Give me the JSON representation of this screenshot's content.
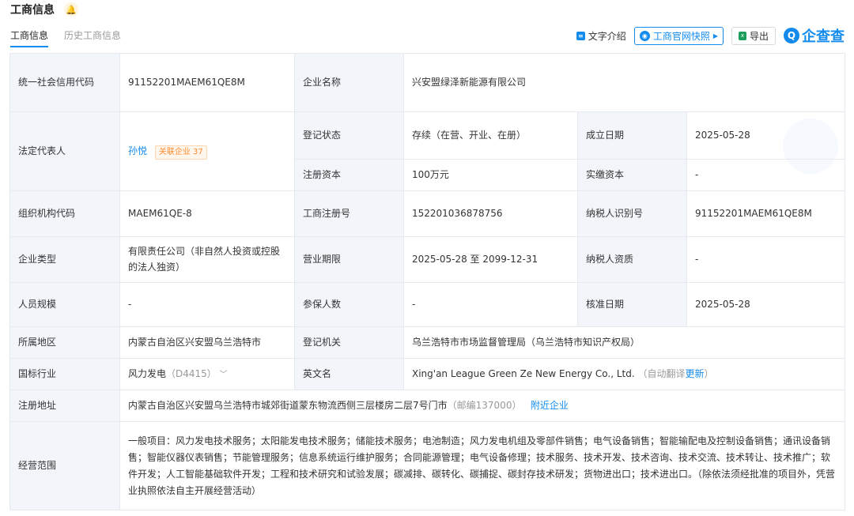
{
  "header": {
    "title": "工商信息"
  },
  "tabs": [
    {
      "label": "工商信息"
    },
    {
      "label": "历史工商信息"
    }
  ],
  "toolbar": {
    "text_intro": "文字介绍",
    "snapshot": "工商官网快照",
    "export": "导出",
    "logo_text": "企查查"
  },
  "rows": {
    "credit_code": {
      "label": "统一社会信用代码",
      "value": "91152201MAEM61QE8M"
    },
    "company_name": {
      "label": "企业名称",
      "value": "兴安盟绿泽新能源有限公司"
    },
    "legal_rep": {
      "label": "法定代表人",
      "name": "孙悦",
      "tag": "关联企业 37"
    },
    "reg_status": {
      "label": "登记状态",
      "value": "存续（在营、开业、在册）"
    },
    "est_date": {
      "label": "成立日期",
      "value": "2025-05-28"
    },
    "reg_capital": {
      "label": "注册资本",
      "value": "100万元"
    },
    "paid_capital": {
      "label": "实缴资本",
      "value": "-"
    },
    "org_code": {
      "label": "组织机构代码",
      "value": "MAEM61QE-8"
    },
    "reg_no": {
      "label": "工商注册号",
      "value": "152201036878756"
    },
    "taxpayer_id": {
      "label": "纳税人识别号",
      "value": "91152201MAEM61QE8M"
    },
    "company_type": {
      "label": "企业类型",
      "value": "有限责任公司（非自然人投资或控股的法人独资）"
    },
    "biz_term": {
      "label": "营业期限",
      "value": "2025-05-28 至 2099-12-31"
    },
    "taxpayer_qual": {
      "label": "纳税人资质",
      "value": "-"
    },
    "staff_size": {
      "label": "人员规模",
      "value": "-"
    },
    "insured": {
      "label": "参保人数",
      "value": "-"
    },
    "approve_date": {
      "label": "核准日期",
      "value": "2025-05-28"
    },
    "region": {
      "label": "所属地区",
      "value": "内蒙古自治区兴安盟乌兰浩特市"
    },
    "reg_authority": {
      "label": "登记机关",
      "value": "乌兰浩特市市场监督管理局（乌兰浩特市知识产权局）"
    },
    "industry": {
      "label": "国标行业",
      "value": "风力发电",
      "code": "（D4415）"
    },
    "english_name": {
      "label": "英文名",
      "value": "Xing'an League Green Ze New Energy Co., Ltd.",
      "note": "（自动翻译",
      "update": "更新",
      "note_end": "）"
    },
    "reg_address": {
      "label": "注册地址",
      "value": "内蒙古自治区兴安盟乌兰浩特市城郊街道蒙东物流西侧三层楼房二层7号门市",
      "postcode": "（邮编137000）",
      "nearby": "附近企业"
    },
    "biz_scope": {
      "label": "经营范围",
      "value": "一般项目：风力发电技术服务；太阳能发电技术服务；储能技术服务；电池制造；风力发电机组及零部件销售；电气设备销售；智能输配电及控制设备销售；通讯设备销售；智能仪器仪表销售；节能管理服务；信息系统运行维护服务；合同能源管理；电气设备修理；技术服务、技术开发、技术咨询、技术交流、技术转让、技术推广；软件开发；人工智能基础软件开发；工程和技术研究和试验发展；碳减排、碳转化、碳捕捉、碳封存技术研发；货物进出口；技术进出口。（除依法须经批准的项目外，凭营业执照依法自主开展经营活动）"
    }
  }
}
